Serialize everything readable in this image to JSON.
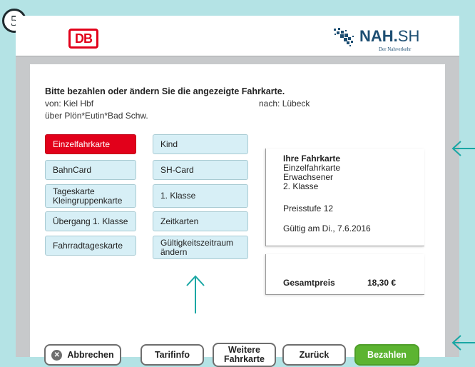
{
  "step_badge": "5",
  "logos": {
    "db": "DB",
    "nah_bold": "NAH.",
    "nah_light": "SH",
    "nah_sub": "Der Nahverkehr"
  },
  "route": {
    "heading": "Bitte bezahlen oder ändern Sie die angezeigte Fahrkarte.",
    "from": "von: Kiel Hbf",
    "to": "nach: Lübeck",
    "via": "über Plön*Eutin*Bad Schw."
  },
  "options_left": [
    {
      "label": "Einzelfahrkarte",
      "selected": true
    },
    {
      "label": "BahnCard",
      "selected": false
    },
    {
      "label": "Tageskarte Kleingruppenkarte",
      "selected": false
    },
    {
      "label": "Übergang 1. Klasse",
      "selected": false
    },
    {
      "label": "Fahrradtageskarte",
      "selected": false
    }
  ],
  "options_right": [
    {
      "label": "Kind"
    },
    {
      "label": "SH-Card"
    },
    {
      "label": "1. Klasse"
    },
    {
      "label": "Zeitkarten"
    },
    {
      "label": "Gültigkeitszeitraum ändern"
    }
  ],
  "ticket": {
    "title": "Ihre Fahrkarte",
    "type": "Einzelfahrkarte",
    "passenger": "Erwachsener",
    "class": "2. Klasse",
    "price_level": "Preisstufe 12",
    "valid": "Gültig am Di., 7.6.2016"
  },
  "total": {
    "label": "Gesamtpreis",
    "amount": "18,30 €"
  },
  "buttons": {
    "cancel": "Abbrechen",
    "tariff": "Tarifinfo",
    "more": "Weitere Fahrkarte",
    "back": "Zurück",
    "pay": "Bezahlen"
  },
  "colors": {
    "accent_teal": "#1aa7a4",
    "db_red": "#e2001a",
    "pay_green": "#5cb431",
    "option_bg": "#d7eff6"
  }
}
